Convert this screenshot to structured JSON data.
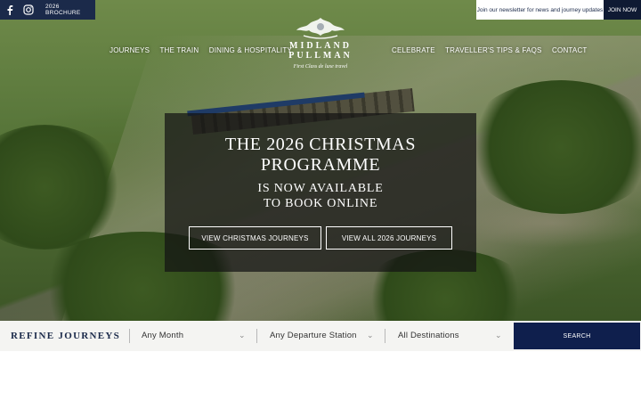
{
  "colors": {
    "navy": "#1b2a4a",
    "dark_navy": "#0f1f4d",
    "refine_bg": "#f4f4f2",
    "overlay": "rgba(20,20,20,0.72)"
  },
  "topbar": {
    "social_icons": [
      "facebook-icon",
      "instagram-icon"
    ],
    "brochure_label": "2026 BROCHURE",
    "newsletter_label": "Join our newsletter for news and journey updates",
    "join_label": "JOIN NOW"
  },
  "nav": {
    "left": [
      "JOURNEYS",
      "THE TRAIN",
      "DINING & HOSPITALITY"
    ],
    "right": [
      "CELEBRATE",
      "TRAVELLER'S TIPS & FAQS",
      "CONTACT"
    ]
  },
  "logo": {
    "name_line1": "MIDLAND",
    "name_line2": "PULLMAN",
    "tagline": "First Class de luxe travel"
  },
  "promo": {
    "title_line1": "THE 2026 CHRISTMAS",
    "title_line2": "PROGRAMME",
    "sub_line1": "IS NOW AVAILABLE",
    "sub_line2": "TO BOOK ONLINE",
    "button_christmas": "VIEW CHRISTMAS JOURNEYS",
    "button_all": "VIEW ALL 2026 JOURNEYS"
  },
  "refine": {
    "title": "REFINE JOURNEYS",
    "month_value": "Any Month",
    "station_value": "Any Departure Station",
    "destination_value": "All Destinations",
    "search_label": "SEARCH"
  }
}
